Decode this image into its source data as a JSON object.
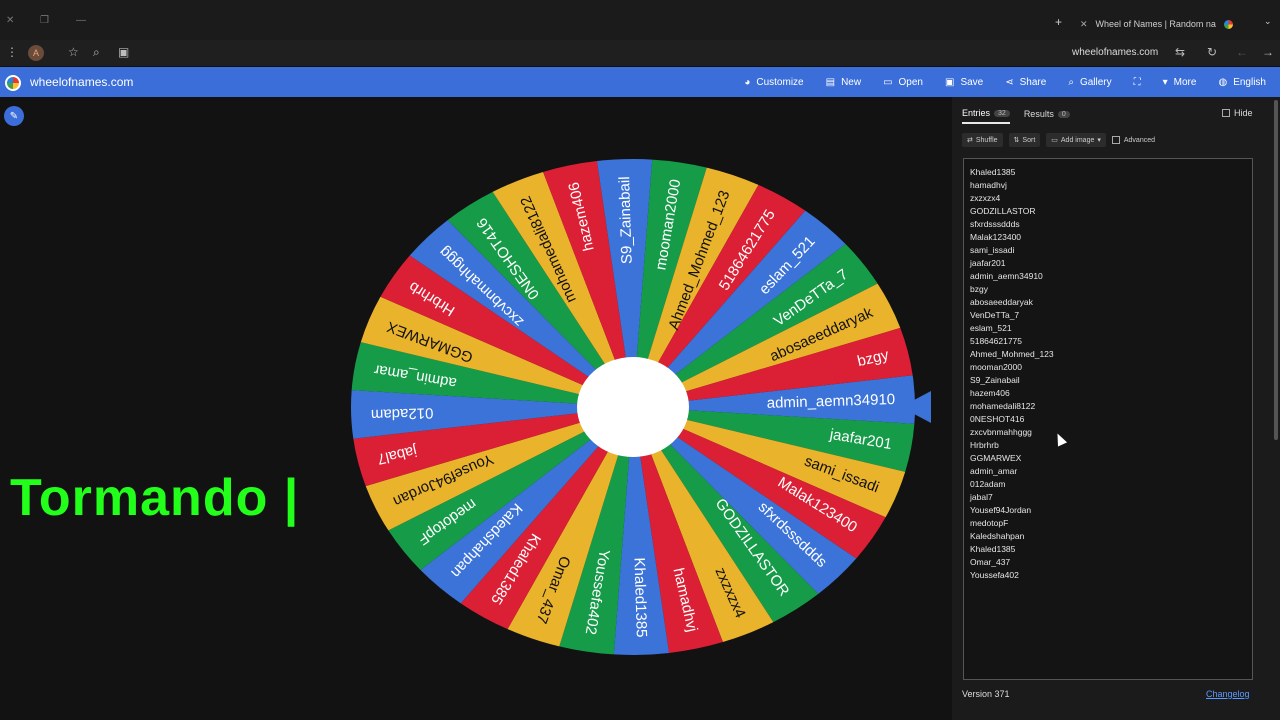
{
  "browser": {
    "tab_title": "Wheel of Names | Random na",
    "url": "wheelofnames.com",
    "profile_initial": "A"
  },
  "app": {
    "site_name": "wheelofnames.com",
    "menu": [
      {
        "icon": "palette-icon",
        "glyph": "◕",
        "label": "Customize"
      },
      {
        "icon": "file-icon",
        "glyph": "▤",
        "label": "New"
      },
      {
        "icon": "folder-icon",
        "glyph": "▭",
        "label": "Open"
      },
      {
        "icon": "save-icon",
        "glyph": "▣",
        "label": "Save"
      },
      {
        "icon": "share-icon",
        "glyph": "⋖",
        "label": "Share"
      },
      {
        "icon": "search-icon",
        "glyph": "⌕",
        "label": "Gallery"
      },
      {
        "icon": "fullscreen-icon",
        "glyph": "⛶",
        "label": ""
      },
      {
        "icon": "chevron-down-icon",
        "glyph": "▾",
        "label": "More"
      },
      {
        "icon": "globe-icon",
        "glyph": "◍",
        "label": "English"
      }
    ],
    "colors": {
      "header": "#3b6ed8",
      "red": "#db1f35",
      "yellow": "#eab32c",
      "green": "#169c49",
      "blue": "#3b73d8"
    }
  },
  "overlay": {
    "text": "Tormando |"
  },
  "wheel": {
    "segments": [
      "admin_aemn34910",
      "jaafar201",
      "sami_issadi",
      "Malak123400",
      "sfxrdsssddds",
      "GODZILLASTOR",
      "zxzxzx4",
      "hamadhvj",
      "Khaled1385",
      "Youssefa402",
      "Omar_437",
      "Khaled1385",
      "Kaledshahpan",
      "medotopF",
      "Yousef94Jordan",
      "jabal7",
      "012adam",
      "admin_amar",
      "GGMARWEX",
      "Hrbrhrb",
      "zxcvbnmahhggg",
      "0NESHOT416",
      "mohamedali8122",
      "hazem406",
      "S9_Zainabail",
      "mooman2000",
      "Ahmed_Mohmed_123",
      "51864621775",
      "eslam_521",
      "VenDeTTa_7",
      "abosaeeddaryak",
      "bzgy"
    ]
  },
  "panel": {
    "tabs": [
      {
        "label": "Entries",
        "count": "32",
        "active": true
      },
      {
        "label": "Results",
        "count": "0",
        "active": false
      }
    ],
    "hide_label": "Hide",
    "actions": {
      "shuffle": "Shuffle",
      "sort": "Sort",
      "add_image": "Add image",
      "advanced": "Advanced"
    },
    "entries": [
      "Khaled1385",
      "hamadhvj",
      "zxzxzx4",
      "GODZILLASTOR",
      "sfxrdsssddds",
      "Malak123400",
      "sami_issadi",
      "jaafar201",
      "admin_aemn34910",
      "bzgy",
      "abosaeeddaryak",
      "VenDeTTa_7",
      "eslam_521",
      "51864621775",
      "Ahmed_Mohmed_123",
      "mooman2000",
      "S9_Zainabail",
      "hazem406",
      "mohamedali8122",
      "0NESHOT416",
      "zxcvbnmahhggg",
      "Hrbrhrb",
      "GGMARWEX",
      "admin_amar",
      "012adam",
      "jabal7",
      "Yousef94Jordan",
      "medotopF",
      "Kaledshahpan",
      "Khaled1385",
      "Omar_437",
      "Youssefa402"
    ],
    "version": "Version 371",
    "changelog": "Changelog"
  }
}
